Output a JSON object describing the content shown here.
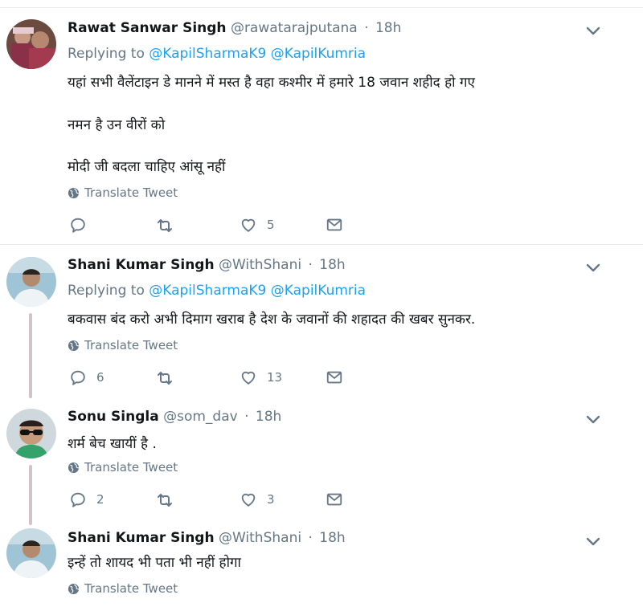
{
  "translate_label": "Translate Tweet",
  "tweets": [
    {
      "name": "Rawat Sanwar Singh",
      "handle": "@rawatarajputana",
      "time": "18h",
      "replying_prefix": "Replying to",
      "replying_to": [
        "@KapilSharmaK9",
        "@KapilKumria"
      ],
      "lines": [
        "यहां सभी वैलेंटाइन डे मानने में मस्त है वहा कश्मीर में हमारे 18 जवान शहीद हो गए",
        "नमन है उन वीरों को",
        "मोदी जी बदला चाहिए आंसू नहीं"
      ],
      "replies": "",
      "retweets": "",
      "likes": "5"
    },
    {
      "name": "Shani Kumar Singh",
      "handle": "@WithShani",
      "time": "18h",
      "replying_prefix": "Replying to",
      "replying_to": [
        "@KapilSharmaK9",
        "@KapilKumria"
      ],
      "lines": [
        "बकवास बंद करो अभी दिमाग खराब है देश के जवानों की शहादत की खबर सुनकर."
      ],
      "replies": "6",
      "retweets": "",
      "likes": "13"
    },
    {
      "name": "Sonu Singla",
      "handle": "@som_dav",
      "time": "18h",
      "lines": [
        "शर्म बेच खायीं है ."
      ],
      "replies": "2",
      "retweets": "",
      "likes": "3"
    },
    {
      "name": "Shani Kumar Singh",
      "handle": "@WithShani",
      "time": "18h",
      "lines": [
        "इन्हें तो शायद भी पता भी नहीं होगा"
      ]
    }
  ],
  "icons": {
    "reply": "reply-icon",
    "retweet": "retweet-icon",
    "like": "heart-icon",
    "message": "envelope-icon",
    "menu": "chevron-down-icon",
    "globe": "globe-icon"
  },
  "colors": {
    "link": "#1da1f2",
    "muted": "#657786",
    "text": "#14171a",
    "divider": "#e6ecf0",
    "thread": "#d4c2cb"
  }
}
